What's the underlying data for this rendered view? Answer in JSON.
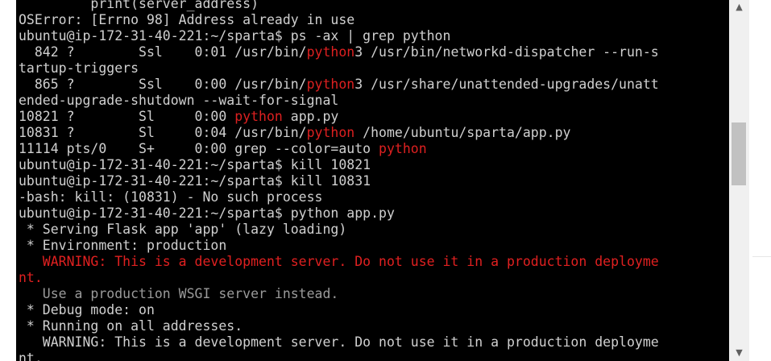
{
  "terminal": {
    "lines": [
      [
        {
          "t": "         print(server_address)"
        }
      ],
      [
        {
          "t": "OSError: [Errno 98] Address already in use"
        }
      ],
      [
        {
          "t": "ubuntu@ip-172-31-40-221:~/sparta$ ps -ax | grep python"
        }
      ],
      [
        {
          "t": "  842 ?        Ssl    0:01 /usr/bin/"
        },
        {
          "t": "python",
          "c": "red"
        },
        {
          "t": "3 /usr/bin/networkd-dispatcher --run-s"
        }
      ],
      [
        {
          "t": "tartup-triggers"
        }
      ],
      [
        {
          "t": "  865 ?        Ssl    0:00 /usr/bin/"
        },
        {
          "t": "python",
          "c": "red"
        },
        {
          "t": "3 /usr/share/unattended-upgrades/unatt"
        }
      ],
      [
        {
          "t": "ended-upgrade-shutdown --wait-for-signal"
        }
      ],
      [
        {
          "t": "10821 ?        Sl     0:00 "
        },
        {
          "t": "python",
          "c": "red"
        },
        {
          "t": " app.py"
        }
      ],
      [
        {
          "t": "10831 ?        Sl     0:04 /usr/bin/"
        },
        {
          "t": "python",
          "c": "red"
        },
        {
          "t": " /home/ubuntu/sparta/app.py"
        }
      ],
      [
        {
          "t": "11114 pts/0    S+     0:00 grep --color=auto "
        },
        {
          "t": "python",
          "c": "red"
        }
      ],
      [
        {
          "t": "ubuntu@ip-172-31-40-221:~/sparta$ kill 10821"
        }
      ],
      [
        {
          "t": "ubuntu@ip-172-31-40-221:~/sparta$ kill 10831"
        }
      ],
      [
        {
          "t": "-bash: kill: (10831) - No such process"
        }
      ],
      [
        {
          "t": "ubuntu@ip-172-31-40-221:~/sparta$ python app.py"
        }
      ],
      [
        {
          "t": " * Serving Flask app 'app' (lazy loading)"
        }
      ],
      [
        {
          "t": " * Environment: production"
        }
      ],
      [
        {
          "t": "   WARNING: This is a development server. Do not use it in a production deployme",
          "c": "bred"
        }
      ],
      [
        {
          "t": "nt.",
          "c": "bred"
        }
      ],
      [
        {
          "t": "   Use a production WSGI server instead.",
          "c": "grey"
        }
      ],
      [
        {
          "t": " * Debug mode: on"
        }
      ],
      [
        {
          "t": " * Running on all addresses."
        }
      ],
      [
        {
          "t": "   WARNING: This is a development server. Do not use it in a production deployme"
        }
      ],
      [
        {
          "t": "nt."
        }
      ]
    ]
  },
  "scrollbar": {
    "up_arrow": "▲",
    "down_arrow": "▼"
  }
}
